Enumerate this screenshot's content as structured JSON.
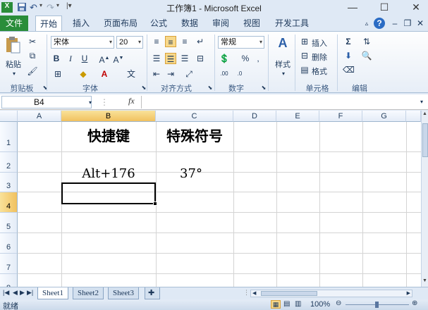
{
  "window": {
    "title": "工作簿1 - Microsoft Excel",
    "minimize": "—",
    "maximize": "☐",
    "close": "✕"
  },
  "ribbon_tabs": [
    "文件",
    "开始",
    "插入",
    "页面布局",
    "公式",
    "数据",
    "审阅",
    "视图",
    "开发工具"
  ],
  "ribbon": {
    "clipboard": {
      "paste": "粘贴",
      "label": "剪贴板"
    },
    "font": {
      "name": "宋体",
      "size": "20",
      "label": "字体"
    },
    "alignment": {
      "label": "对齐方式"
    },
    "number": {
      "format": "常规",
      "label": "数字"
    },
    "styles": {
      "button": "样式"
    },
    "cells": {
      "insert": "插入",
      "delete": "删除",
      "format": "格式",
      "label": "单元格"
    },
    "editing": {
      "label": "编辑"
    }
  },
  "formula_bar": {
    "name_box": "B4",
    "fx": "fx",
    "value": ""
  },
  "grid": {
    "columns": [
      "A",
      "B",
      "C",
      "D",
      "E",
      "F",
      "G"
    ],
    "rows": [
      "1",
      "2",
      "3",
      "4",
      "5",
      "6",
      "7",
      "8"
    ],
    "selected_cell": "B4",
    "cells": {
      "B1": "快捷键",
      "C1": "特殊符号",
      "B3": "Alt+176",
      "C3": "37°"
    }
  },
  "sheets": [
    "Sheet1",
    "Sheet2",
    "Sheet3"
  ],
  "active_sheet": "Sheet1",
  "status": {
    "mode": "就绪",
    "zoom": "100%"
  },
  "colors": {
    "file_tab": "#2a8d3a",
    "selection_header": "#f1c15f"
  }
}
